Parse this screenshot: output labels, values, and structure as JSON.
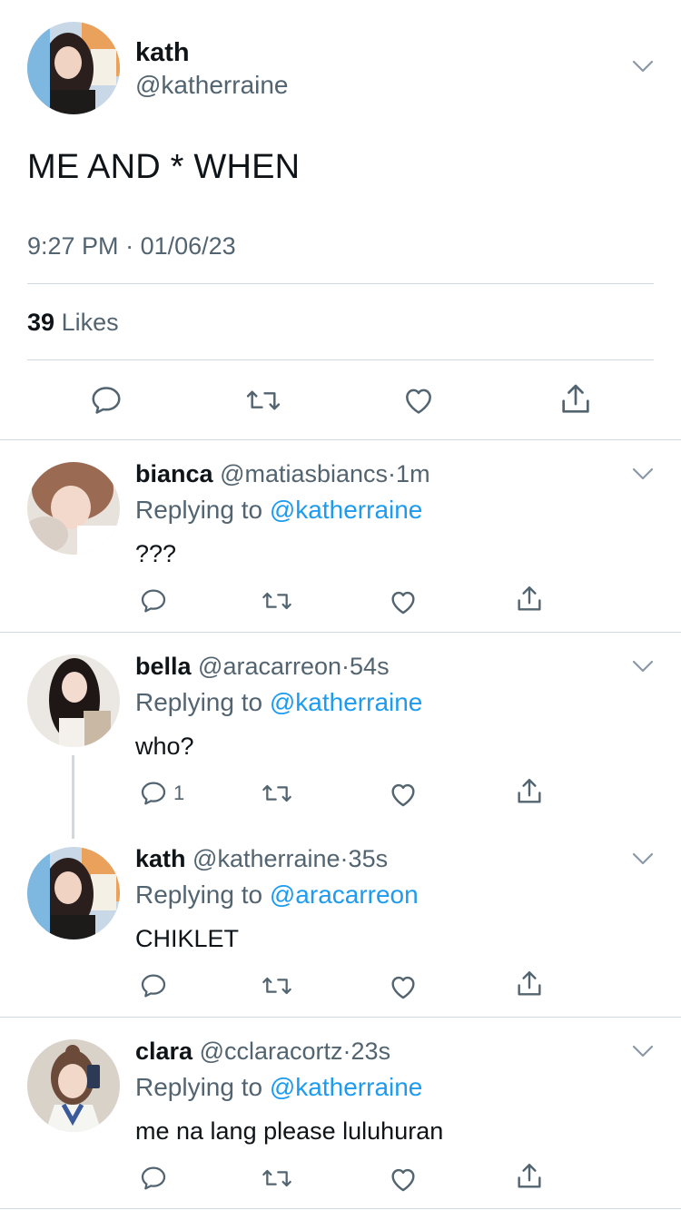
{
  "main_tweet": {
    "name": "kath",
    "handle": "@katherraine",
    "text": "ME AND * WHEN",
    "time": "9:27 PM",
    "separator": "·",
    "date": "01/06/23",
    "likes_count": "39",
    "likes_label": "Likes"
  },
  "replies": [
    {
      "name": "bianca",
      "handle": "@matiasbiancs",
      "sep": "·",
      "age": "1m",
      "replying_prefix": "Replying to",
      "replying_to": "@katherraine",
      "text": "???",
      "reply_count": ""
    },
    {
      "name": "bella",
      "handle": "@aracarreon",
      "sep": "·",
      "age": "54s",
      "replying_prefix": "Replying to",
      "replying_to": "@katherraine",
      "text": "who?",
      "reply_count": "1"
    },
    {
      "name": "kath",
      "handle": "@katherraine",
      "sep": "·",
      "age": "35s",
      "replying_prefix": "Replying to",
      "replying_to": "@aracarreon",
      "text": "CHIKLET",
      "reply_count": ""
    },
    {
      "name": "clara",
      "handle": "@cclaracortz",
      "sep": "·",
      "age": "23s",
      "replying_prefix": "Replying to",
      "replying_to": "@katherraine",
      "text": "me na lang please luluhuran",
      "reply_count": ""
    }
  ],
  "icons": {
    "reply": "reply-icon",
    "retweet": "retweet-icon",
    "like": "heart-icon",
    "share": "share-icon",
    "more": "chevron-down-icon"
  },
  "colors": {
    "accent": "#1d9bf0",
    "secondary_text": "#536471",
    "divider": "#cfd9de"
  }
}
